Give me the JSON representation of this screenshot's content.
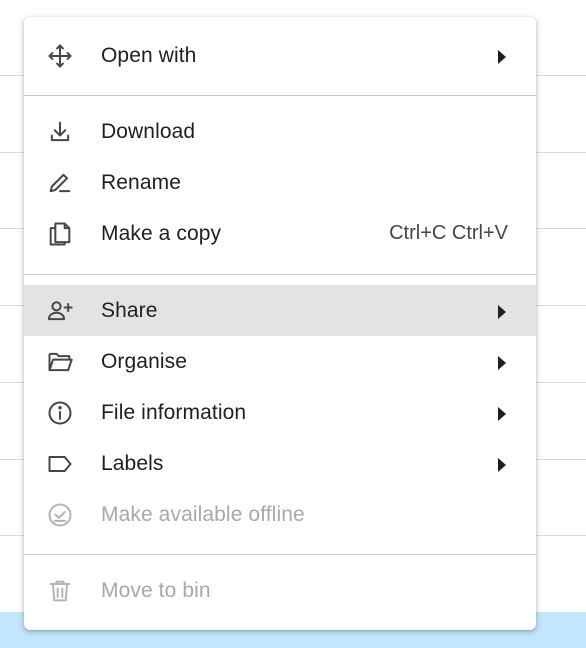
{
  "menu": {
    "items": [
      {
        "label": "Open with",
        "icon": "move-arrows-icon",
        "submenu": true
      },
      {
        "label": "Download",
        "icon": "download-icon"
      },
      {
        "label": "Rename",
        "icon": "pencil-icon"
      },
      {
        "label": "Make a copy",
        "icon": "copy-icon",
        "shortcut": "Ctrl+C Ctrl+V"
      },
      {
        "label": "Share",
        "icon": "person-add-icon",
        "submenu": true,
        "highlighted": true
      },
      {
        "label": "Organise",
        "icon": "folder-open-icon",
        "submenu": true
      },
      {
        "label": "File information",
        "icon": "info-icon",
        "submenu": true
      },
      {
        "label": "Labels",
        "icon": "label-icon",
        "submenu": true
      },
      {
        "label": "Make available offline",
        "icon": "offline-check-icon",
        "disabled": true
      },
      {
        "label": "Move to bin",
        "icon": "trash-icon",
        "disabled": true
      }
    ]
  },
  "colors": {
    "highlight": "#e3e3e3",
    "text": "#1f1f1f",
    "disabled_text": "#a8a8a8",
    "selected_row_bg": "#c2e7ff"
  }
}
